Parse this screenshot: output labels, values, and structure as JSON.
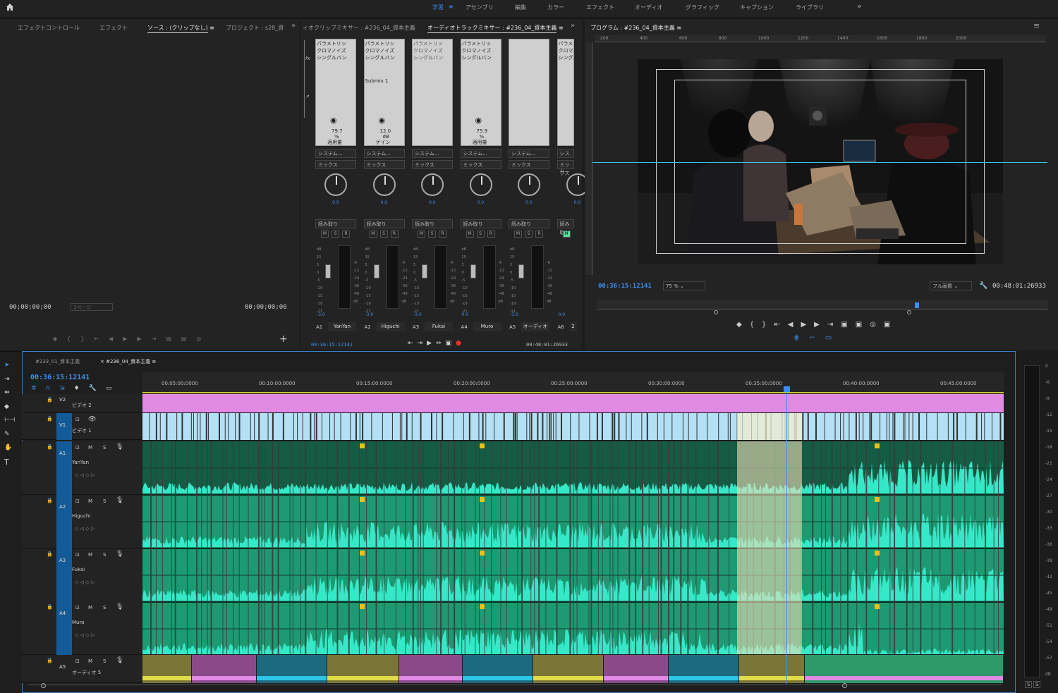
{
  "workspaces": {
    "items": [
      "学習",
      "アセンブリ",
      "編集",
      "カラー",
      "エフェクト",
      "オーディオ",
      "グラフィック",
      "キャプション",
      "ライブラリ"
    ],
    "active": "学習",
    "more": "»"
  },
  "source_panel": {
    "tabs": [
      "エフェクトコントロール",
      "エフェクト",
      "ソース : (クリップなし)",
      "プロジェクト : s28_資"
    ],
    "timecode_in": "00;00;00;00",
    "timecode_out": "00;00;00;00",
    "page": "1ページ"
  },
  "mixer": {
    "tabs": [
      "ィオクリップミキサー : #236_04_資本主義",
      "オーディオトラックミキサー : #236_04_資本主義"
    ],
    "fx_labels": [
      "パラメトリッ",
      "クロマノイズ",
      "シングルバン"
    ],
    "submix": "Submix 1",
    "values": [
      "79.7",
      "12.0",
      "",
      "75.9",
      ""
    ],
    "units": [
      "%",
      "dB",
      "",
      "%",
      ""
    ],
    "value_labels": [
      "適用量",
      "ゲイン",
      "",
      "適用量",
      ""
    ],
    "system": "システム...",
    "mix": "ミックス",
    "pan": "0.0",
    "read": "読み取り",
    "db_values": [
      "-3.0",
      "-3.0",
      "-3.0",
      "0.0",
      "-3.0",
      "0.0"
    ],
    "track_ids": [
      "A1",
      "A2",
      "A3",
      "A4",
      "A5",
      "A6"
    ],
    "track_names": [
      "YanYan",
      "Higuchi",
      "Fukai",
      "Muro",
      "オーディオ",
      "2"
    ],
    "scale": [
      "dB",
      "15",
      "5",
      "0",
      "-5",
      "-10",
      "-15",
      "-19",
      "-21"
    ],
    "right_scale": [
      "-6",
      "-12",
      "-24",
      "-36",
      "-48",
      "dB"
    ],
    "current_time": "00:36:15:12141",
    "duration": "00:48:01:26933"
  },
  "program": {
    "tab": "プログラム : #236_04_資本主義",
    "ruler": [
      "200",
      "400",
      "600",
      "800",
      "1000",
      "1200",
      "1400",
      "1600",
      "1800",
      "2000"
    ],
    "timecode": "00:36:15:12141",
    "zoom": "75 %",
    "quality": "フル画質",
    "duration": "00:48:01:26933",
    "playhead": 0.71
  },
  "timeline": {
    "tabs": [
      "#233_01_資本主義",
      "#236_04_資本主義"
    ],
    "timecode": "00:36:15:12141",
    "ruler": [
      "00:05:00:0000",
      "00:10:00:0000",
      "00:15:00:0000",
      "00:20:00:0000",
      "00:25:00:0000",
      "00:30:00:0000",
      "00:35:00:0000",
      "00:40:00:0000",
      "00:45:00:0000"
    ],
    "tracks": [
      {
        "id": "V2",
        "name": "ビデオ 2"
      },
      {
        "id": "V1",
        "name": "ビデオ 1"
      },
      {
        "id": "A1",
        "name": "YanYan"
      },
      {
        "id": "A2",
        "name": "Higuchi"
      },
      {
        "id": "A3",
        "name": "Fukai"
      },
      {
        "id": "A4",
        "name": "Muro"
      },
      {
        "id": "A5",
        "name": "オーディオ 5"
      }
    ],
    "msr": [
      "M",
      "S"
    ],
    "meter_scale": [
      "0",
      "-6",
      "-9",
      "-12",
      "-15",
      "-18",
      "-21",
      "-24",
      "-27",
      "-30",
      "-33",
      "-36",
      "-39",
      "-42",
      "-45",
      "-48",
      "-51",
      "-54",
      "-57",
      "dB"
    ],
    "solo": [
      "S",
      "S"
    ]
  },
  "colors": {
    "accent": "#3a8ef5",
    "v2": "#dd88dd",
    "v1": "#a9dcf2",
    "audio": "#1fa37a",
    "wave": "#38e8cc",
    "highlight": "#efe3c2"
  }
}
